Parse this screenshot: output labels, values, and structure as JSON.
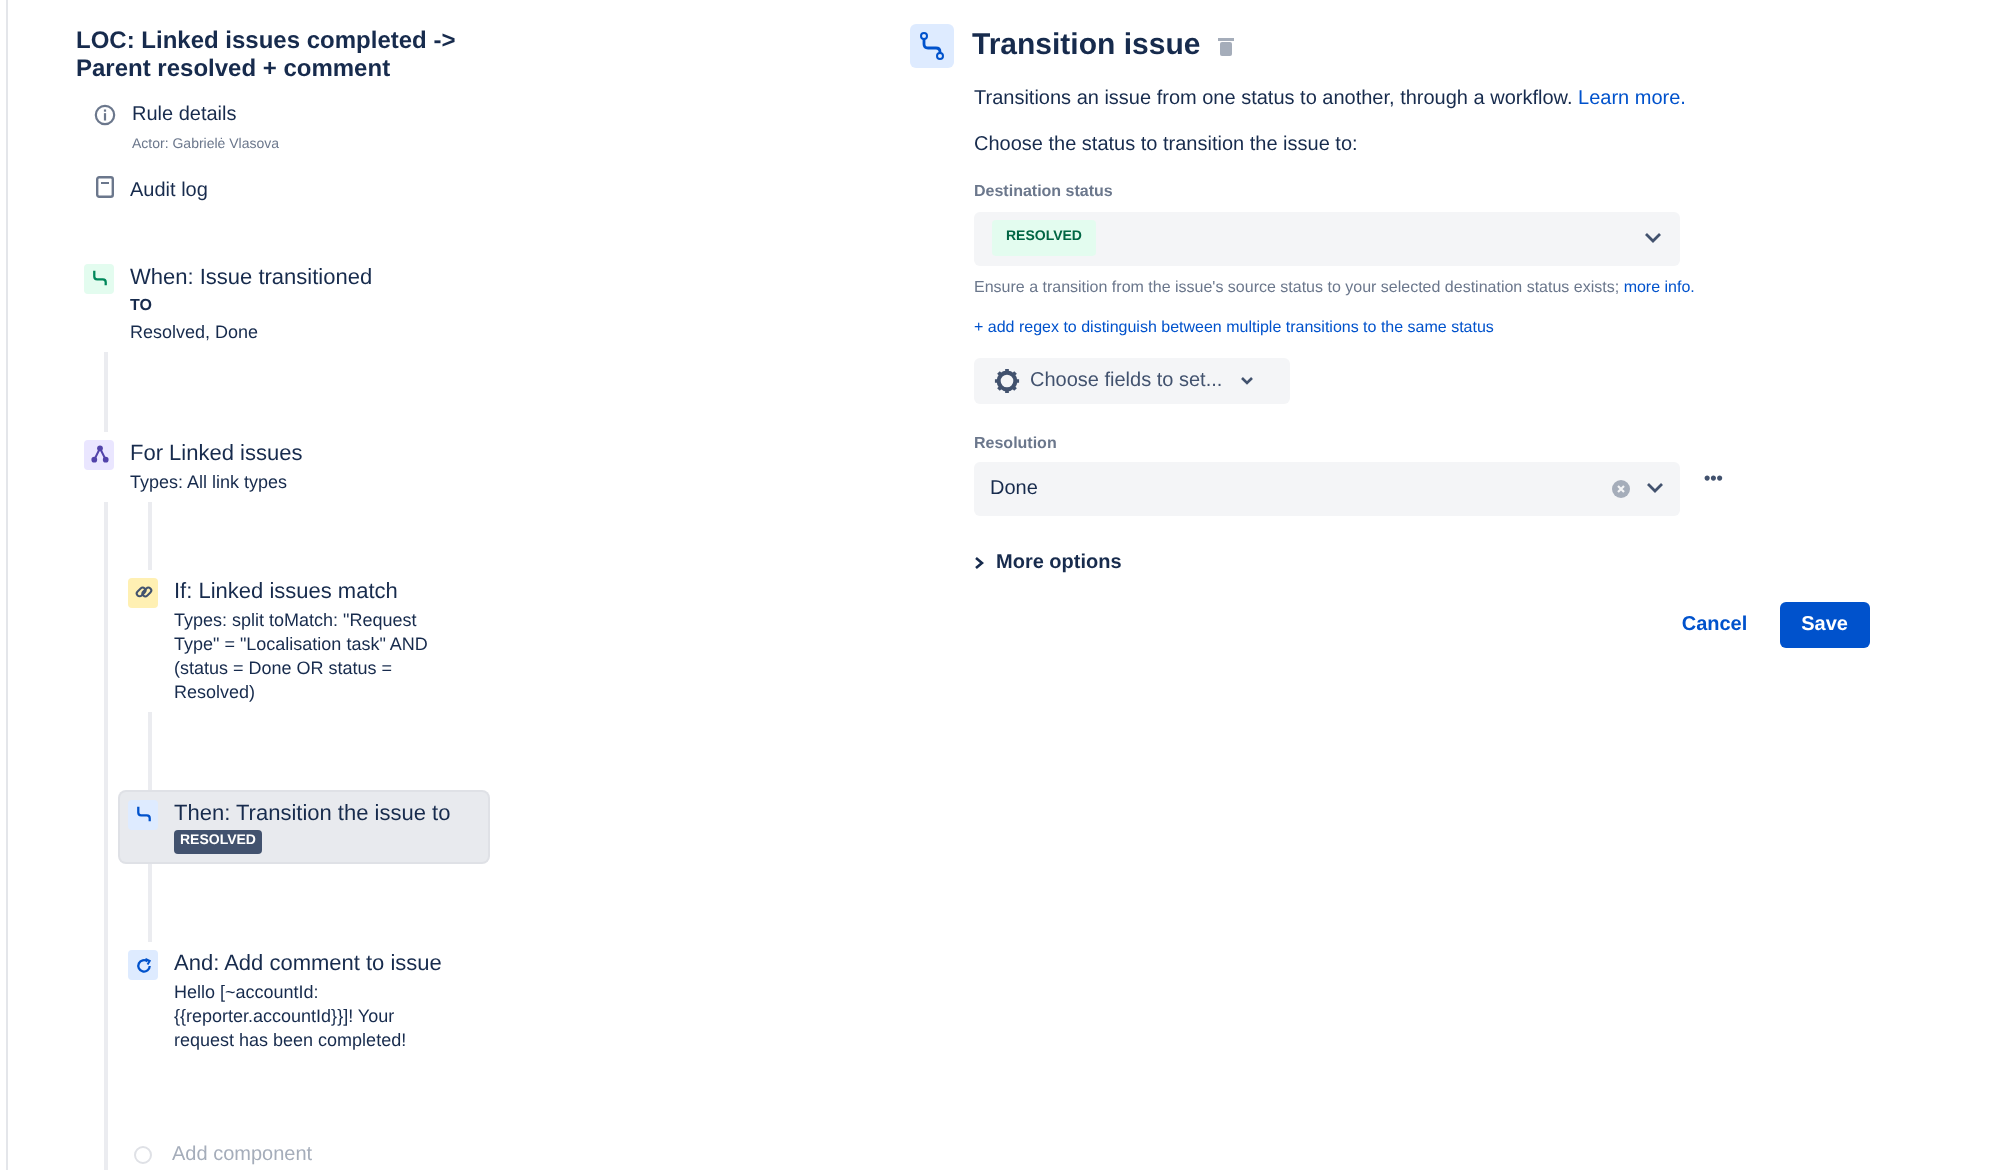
{
  "rule": {
    "title": "LOC: Linked issues completed -> Parent resolved + comment",
    "details_label": "Rule details",
    "actor": "Actor: Gabrielė Vlasova",
    "audit_label": "Audit log"
  },
  "components": [
    {
      "kind": "trigger",
      "title": "When: Issue transitioned",
      "sub_label": "TO",
      "detail": "Resolved, Done",
      "selected": false
    },
    {
      "kind": "branch",
      "title": "For Linked issues",
      "detail": "Types: All link types",
      "selected": false,
      "children": [
        {
          "kind": "condition",
          "title": "If: Linked issues match",
          "detail": "Types: split toMatch: \"Request Type\" = \"Localisation task\" AND (status = Done OR status = Resolved)",
          "selected": false
        },
        {
          "kind": "action",
          "title": "Then: Transition the issue to",
          "badge": "RESOLVED",
          "selected": true
        },
        {
          "kind": "comment",
          "title": "And: Add comment to issue",
          "detail": "Hello [~accountId: {{reporter.accountId}}]! Your request has been completed!",
          "selected": false
        }
      ]
    }
  ],
  "add_component": "Add component",
  "editor": {
    "title": "Transition issue",
    "description": "Transitions an issue from one status to another, through a workflow.",
    "learn_more": "Learn more.",
    "prompt": "Choose the status to transition the issue to:",
    "destination_label": "Destination status",
    "destination_value": "RESOLVED",
    "help": "Ensure a transition from the issue's source status to your selected destination status exists;",
    "more_info": "more info.",
    "regex_link": "+ add regex to distinguish between multiple transitions to the same status",
    "fields_button": "Choose fields to set...",
    "resolution_label": "Resolution",
    "resolution_value": "Done",
    "more_actions": "•••",
    "more_options": "More options",
    "cancel": "Cancel",
    "save": "Save"
  }
}
